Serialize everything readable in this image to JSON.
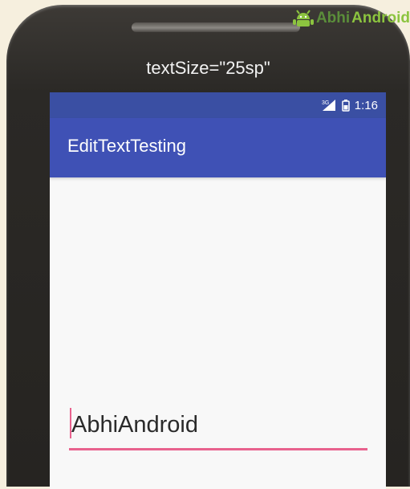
{
  "watermark": {
    "prefix": "Abhi",
    "suffix": "Android"
  },
  "device": {
    "label": "textSize=\"25sp\""
  },
  "status_bar": {
    "network": "3G",
    "time": "1:16"
  },
  "toolbar": {
    "title": "EditTextTesting"
  },
  "edit_text": {
    "value": "AbhiAndroid"
  },
  "colors": {
    "primary": "#3f51b5",
    "primary_dark": "#3a4fa3",
    "accent": "#e8628e",
    "watermark_dark": "#5b8e3a",
    "watermark_light": "#8cc43f"
  }
}
